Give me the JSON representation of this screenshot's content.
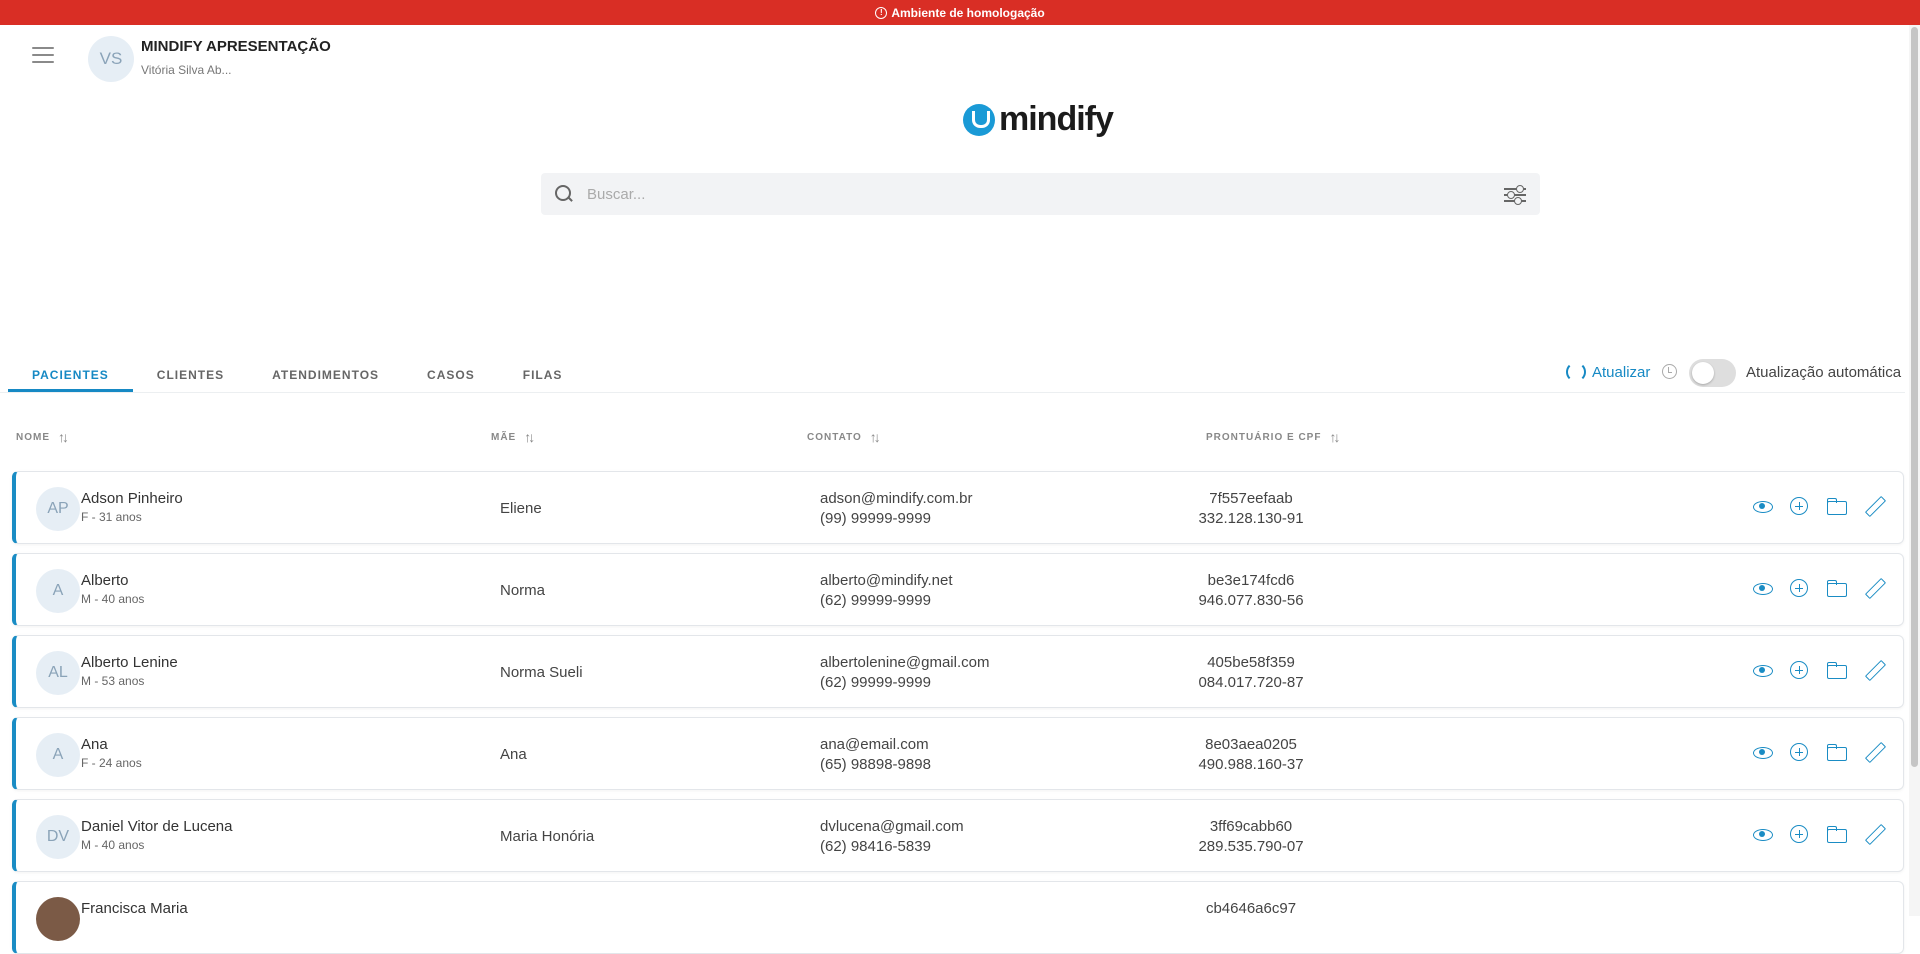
{
  "banner": {
    "text": "Ambiente de homologação"
  },
  "header": {
    "org_initials": "VS",
    "org_name": "MINDIFY APRESENTAÇÃO",
    "user_name": "Vitória Silva Ab...",
    "logo_text": "mindify"
  },
  "search": {
    "placeholder": "Buscar..."
  },
  "tabs": [
    {
      "label": "PACIENTES",
      "active": true
    },
    {
      "label": "CLIENTES"
    },
    {
      "label": "ATENDIMENTOS"
    },
    {
      "label": "CASOS"
    },
    {
      "label": "FILAS"
    }
  ],
  "toolbar": {
    "refresh_label": "Atualizar",
    "auto_refresh_label": "Atualização automática",
    "auto_refresh_on": false
  },
  "columns": {
    "name": "NOME",
    "mother": "MÃE",
    "contact": "CONTATO",
    "record": "PRONTUÁRIO E CPF"
  },
  "patients": [
    {
      "initials": "AP",
      "name": "Adson Pinheiro",
      "info": "F - 31 anos",
      "mother": "Eliene",
      "email": "adson@mindify.com.br",
      "phone": "(99) 99999-9999",
      "record": "7f557eefaab",
      "cpf": "332.128.130-91"
    },
    {
      "initials": "A",
      "name": "Alberto",
      "info": "M - 40 anos",
      "mother": "Norma",
      "email": "alberto@mindify.net",
      "phone": "(62) 99999-9999",
      "record": "be3e174fcd6",
      "cpf": "946.077.830-56"
    },
    {
      "initials": "AL",
      "name": "Alberto Lenine",
      "info": "M - 53 anos",
      "mother": "Norma Sueli",
      "email": "albertolenine@gmail.com",
      "phone": "(62) 99999-9999",
      "record": "405be58f359",
      "cpf": "084.017.720-87"
    },
    {
      "initials": "A",
      "name": "Ana",
      "info": "F - 24 anos",
      "mother": "Ana",
      "email": "ana@email.com",
      "phone": "(65) 98898-9898",
      "record": "8e03aea0205",
      "cpf": "490.988.160-37"
    },
    {
      "initials": "DV",
      "name": "Daniel Vitor de Lucena",
      "info": "M - 40 anos",
      "mother": "Maria Honória",
      "email": "dvlucena@gmail.com",
      "phone": "(62) 98416-5839",
      "record": "3ff69cabb60",
      "cpf": "289.535.790-07"
    },
    {
      "initials": "",
      "name": "Francisca Maria",
      "info": "",
      "mother": "",
      "email": "",
      "phone": "",
      "record": "cb4646a6c97",
      "cpf": ""
    }
  ],
  "colors": {
    "accent": "#1689c4",
    "banner": "#d92e25"
  }
}
